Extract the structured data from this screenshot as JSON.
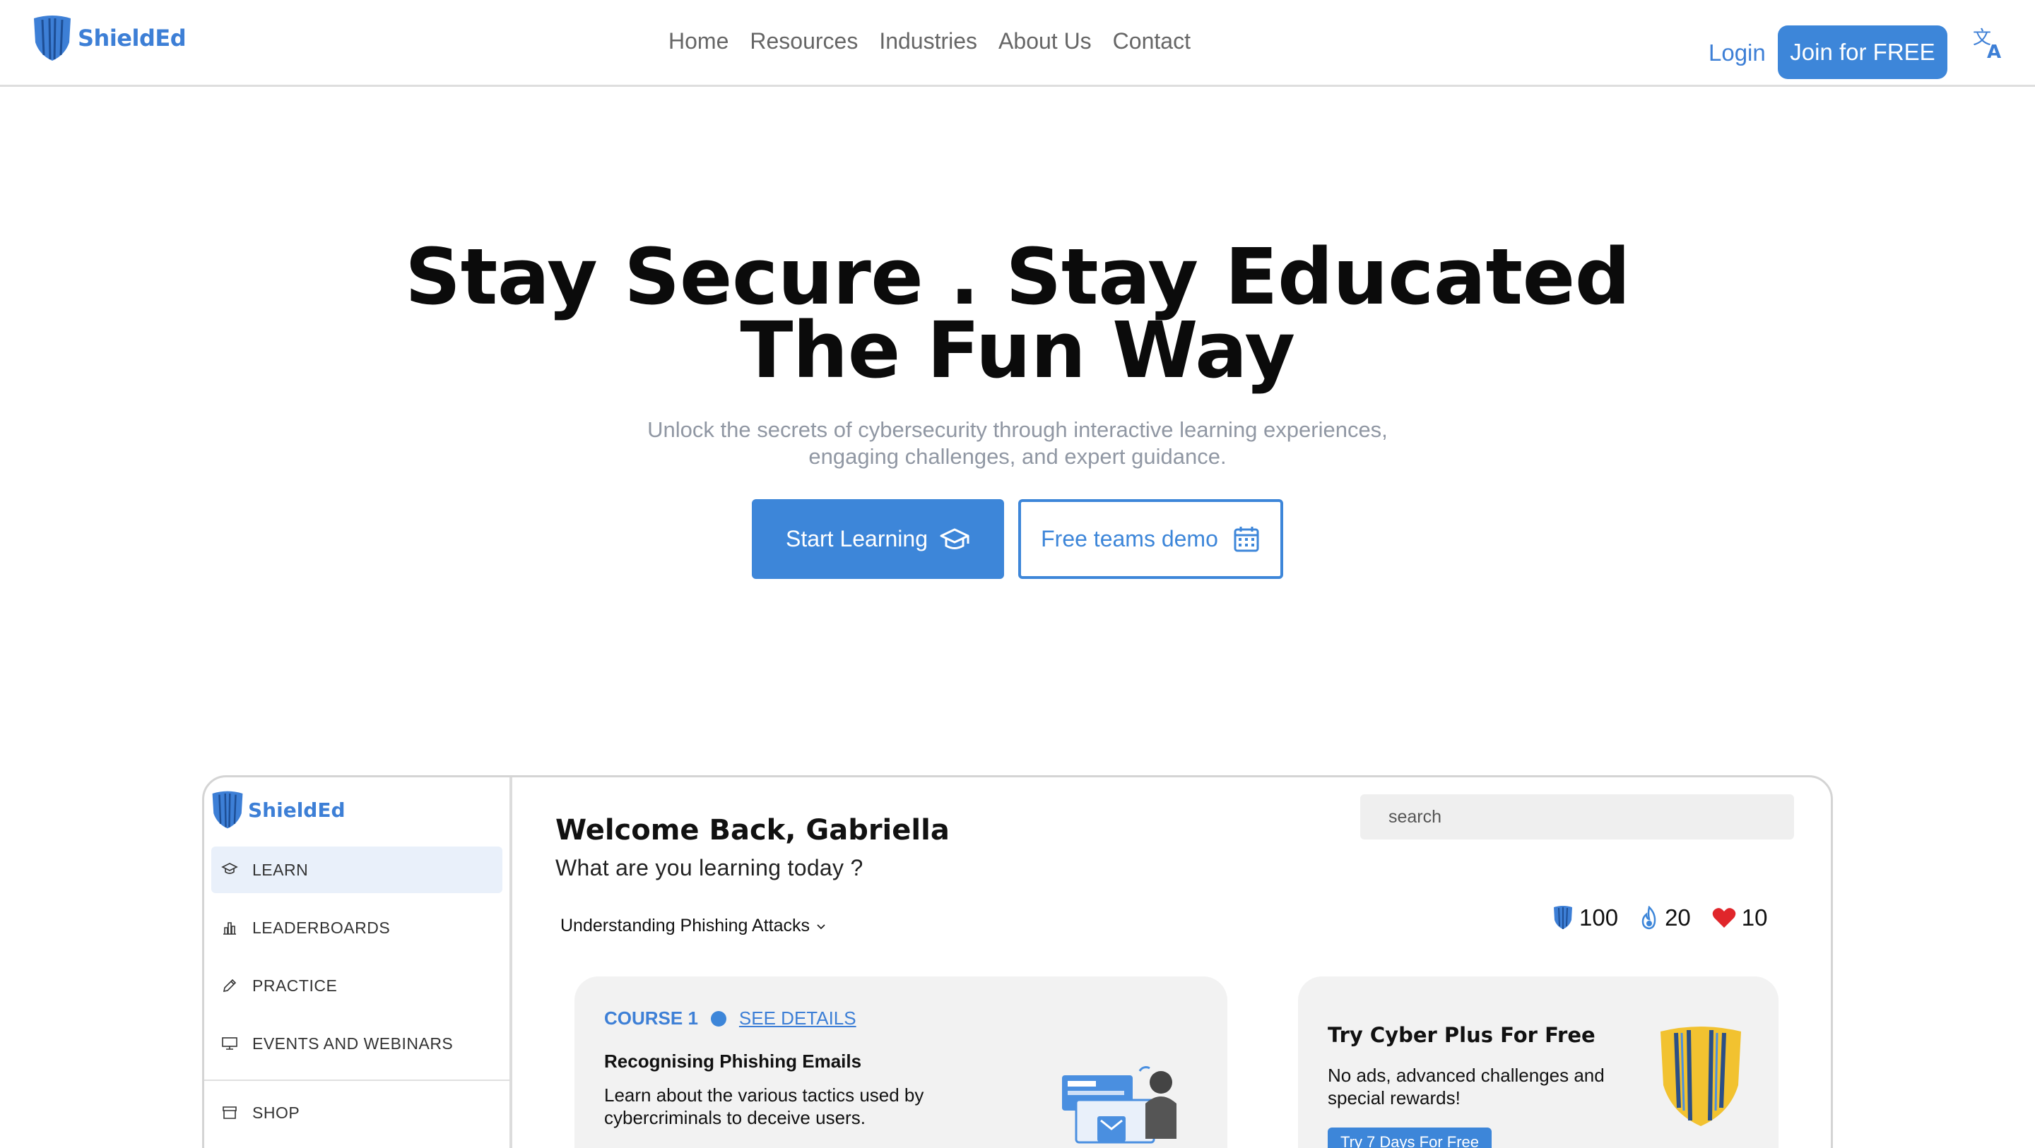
{
  "nav": {
    "brand": "ShieldEd",
    "links": [
      "Home",
      "Resources",
      "Industries",
      "About Us",
      "Contact"
    ],
    "login": "Login",
    "join": "Join for FREE",
    "translate_icon": "translate-icon"
  },
  "hero": {
    "title_line1": "Stay Secure . Stay Educated",
    "title_line2": "The Fun Way",
    "subtitle_line1": "Unlock the secrets of cybersecurity through interactive learning experiences,",
    "subtitle_line2": "engaging challenges, and expert guidance.",
    "start_button": "Start Learning",
    "demo_button": "Free teams demo"
  },
  "app_preview": {
    "brand": "ShieldEd",
    "sidebar": {
      "items": [
        {
          "label": "LEARN",
          "icon": "graduation-cap-icon",
          "active": true
        },
        {
          "label": "LEADERBOARDS",
          "icon": "bar-chart-icon",
          "active": false
        },
        {
          "label": "PRACTICE",
          "icon": "pencil-icon",
          "active": false
        },
        {
          "label": "EVENTS AND WEBINARS",
          "icon": "monitor-icon",
          "active": false
        },
        {
          "label": "SHOP",
          "icon": "store-icon",
          "active": false
        }
      ]
    },
    "welcome": "Welcome Back, Gabriella",
    "welcome_sub": "What are you learning today ?",
    "search_placeholder": "search",
    "course_select": "Understanding Phishing Attacks",
    "stats": {
      "shields": "100",
      "streak": "20",
      "lives": "10"
    },
    "course_card": {
      "course_label": "COURSE 1",
      "details_link": "SEE DETAILS",
      "title": "Recognising Phishing Emails",
      "description": "Learn about the various tactics used by cybercriminals to deceive users."
    },
    "promo_card": {
      "title": "Try Cyber Plus For Free",
      "description": "No ads, advanced challenges and special rewards!",
      "button": "Try 7 Days For Free"
    }
  },
  "colors": {
    "accent": "#3d86d9",
    "brand_text": "#3d7fd6",
    "subtitle_gray": "#9097a3",
    "card_bg": "#f2f2f2",
    "heart": "#e0262b",
    "gold": "#f2c230"
  }
}
